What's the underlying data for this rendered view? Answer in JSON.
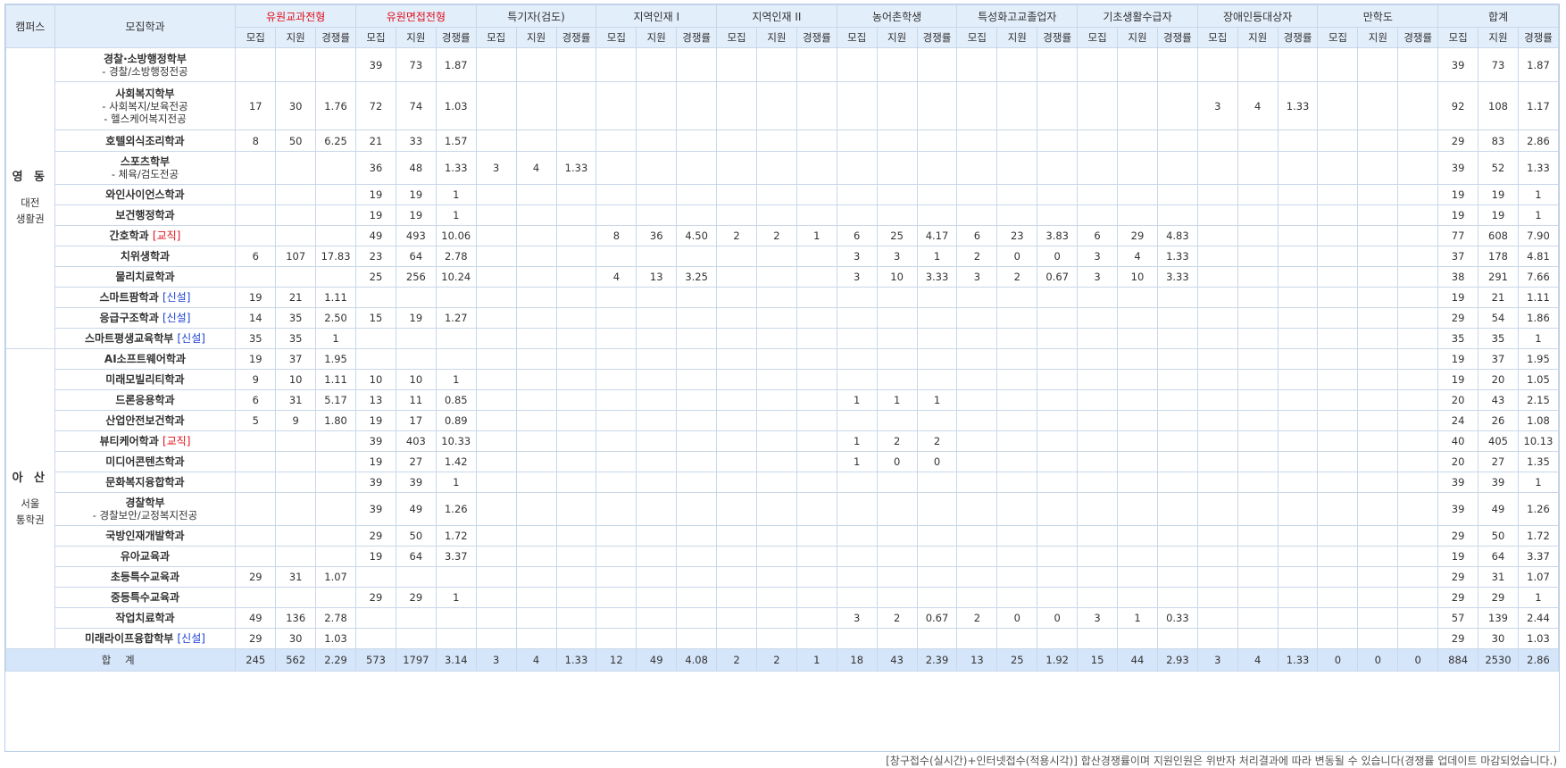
{
  "header": {
    "campus": "캠퍼스",
    "dept": "모집학과",
    "groups": [
      {
        "label": "유원교과전형",
        "red": true
      },
      {
        "label": "유원면접전형",
        "red": true
      },
      {
        "label": "특기자(검도)",
        "red": false
      },
      {
        "label": "지역인재 I",
        "red": false
      },
      {
        "label": "지역인재 II",
        "red": false
      },
      {
        "label": "농어촌학생",
        "red": false
      },
      {
        "label": "특성화고교졸업자",
        "red": false
      },
      {
        "label": "기초생활수급자",
        "red": false
      },
      {
        "label": "장애인등대상자",
        "red": false
      },
      {
        "label": "만학도",
        "red": false
      },
      {
        "label": "합계",
        "red": false
      }
    ],
    "sub": [
      "모집",
      "지원",
      "경쟁률"
    ]
  },
  "campuses": [
    {
      "name": "영 동",
      "region1": "대전",
      "region2": "생활권",
      "rows": [
        {
          "name": "경찰·소방행정학부",
          "sub": [
            "- 경찰/소방행정전공"
          ],
          "h": 38,
          "v": [
            "",
            "",
            "",
            "39",
            "73",
            "1.87",
            "",
            "",
            "",
            "",
            "",
            "",
            "",
            "",
            "",
            "",
            "",
            "",
            "",
            "",
            "",
            "",
            "",
            "",
            "",
            "",
            "",
            "",
            "",
            "",
            "39",
            "73",
            "1.87"
          ]
        },
        {
          "name": "사회복지학부",
          "sub": [
            "- 사회복지/보육전공",
            "- 헬스케어복지전공"
          ],
          "h": 54,
          "v": [
            "17",
            "30",
            "1.76",
            "72",
            "74",
            "1.03",
            "",
            "",
            "",
            "",
            "",
            "",
            "",
            "",
            "",
            "",
            "",
            "",
            "",
            "",
            "",
            "",
            "",
            "",
            "3",
            "4",
            "1.33",
            "",
            "",
            "",
            "92",
            "108",
            "1.17"
          ]
        },
        {
          "name": "호텔외식조리학과",
          "h": 24,
          "v": [
            "8",
            "50",
            "6.25",
            "21",
            "33",
            "1.57",
            "",
            "",
            "",
            "",
            "",
            "",
            "",
            "",
            "",
            "",
            "",
            "",
            "",
            "",
            "",
            "",
            "",
            "",
            "",
            "",
            "",
            "",
            "",
            "",
            "29",
            "83",
            "2.86"
          ]
        },
        {
          "name": "스포츠학부",
          "sub": [
            "- 체육/검도전공"
          ],
          "h": 37,
          "v": [
            "",
            "",
            "",
            "36",
            "48",
            "1.33",
            "3",
            "4",
            "1.33",
            "",
            "",
            "",
            "",
            "",
            "",
            "",
            "",
            "",
            "",
            "",
            "",
            "",
            "",
            "",
            "",
            "",
            "",
            "",
            "",
            "",
            "39",
            "52",
            "1.33"
          ]
        },
        {
          "name": "와인사이언스학과",
          "h": 23,
          "v": [
            "",
            "",
            "",
            "19",
            "19",
            "1",
            "",
            "",
            "",
            "",
            "",
            "",
            "",
            "",
            "",
            "",
            "",
            "",
            "",
            "",
            "",
            "",
            "",
            "",
            "",
            "",
            "",
            "",
            "",
            "",
            "19",
            "19",
            "1"
          ]
        },
        {
          "name": "보건행정학과",
          "h": 23,
          "v": [
            "",
            "",
            "",
            "19",
            "19",
            "1",
            "",
            "",
            "",
            "",
            "",
            "",
            "",
            "",
            "",
            "",
            "",
            "",
            "",
            "",
            "",
            "",
            "",
            "",
            "",
            "",
            "",
            "",
            "",
            "",
            "19",
            "19",
            "1"
          ]
        },
        {
          "name": "간호학과",
          "tag": "[교직]",
          "tagColor": "red",
          "h": 23,
          "v": [
            "",
            "",
            "",
            "49",
            "493",
            "10.06",
            "",
            "",
            "",
            "8",
            "36",
            "4.50",
            "2",
            "2",
            "1",
            "6",
            "25",
            "4.17",
            "6",
            "23",
            "3.83",
            "6",
            "29",
            "4.83",
            "",
            "",
            "",
            "",
            "",
            "",
            "77",
            "608",
            "7.90"
          ]
        },
        {
          "name": "치위생학과",
          "h": 23,
          "v": [
            "6",
            "107",
            "17.83",
            "23",
            "64",
            "2.78",
            "",
            "",
            "",
            "",
            "",
            "",
            "",
            "",
            "",
            "3",
            "3",
            "1",
            "2",
            "0",
            "0",
            "3",
            "4",
            "1.33",
            "",
            "",
            "",
            "",
            "",
            "",
            "37",
            "178",
            "4.81"
          ]
        },
        {
          "name": "물리치료학과",
          "h": 23,
          "v": [
            "",
            "",
            "",
            "25",
            "256",
            "10.24",
            "",
            "",
            "",
            "4",
            "13",
            "3.25",
            "",
            "",
            "",
            "3",
            "10",
            "3.33",
            "3",
            "2",
            "0.67",
            "3",
            "10",
            "3.33",
            "",
            "",
            "",
            "",
            "",
            "",
            "38",
            "291",
            "7.66"
          ]
        },
        {
          "name": "스마트팜학과",
          "tag": "[신설]",
          "tagColor": "blue",
          "h": 23,
          "v": [
            "19",
            "21",
            "1.11",
            "",
            "",
            "",
            "",
            "",
            "",
            "",
            "",
            "",
            "",
            "",
            "",
            "",
            "",
            "",
            "",
            "",
            "",
            "",
            "",
            "",
            "",
            "",
            "",
            "",
            "",
            "",
            "19",
            "21",
            "1.11"
          ]
        },
        {
          "name": "응급구조학과",
          "tag": "[신설]",
          "tagColor": "blue",
          "h": 23,
          "v": [
            "14",
            "35",
            "2.50",
            "15",
            "19",
            "1.27",
            "",
            "",
            "",
            "",
            "",
            "",
            "",
            "",
            "",
            "",
            "",
            "",
            "",
            "",
            "",
            "",
            "",
            "",
            "",
            "",
            "",
            "",
            "",
            "",
            "29",
            "54",
            "1.86"
          ]
        },
        {
          "name": "스마트평생교육학부",
          "tag": "[신설]",
          "tagColor": "blue",
          "h": 23,
          "v": [
            "35",
            "35",
            "1",
            "",
            "",
            "",
            "",
            "",
            "",
            "",
            "",
            "",
            "",
            "",
            "",
            "",
            "",
            "",
            "",
            "",
            "",
            "",
            "",
            "",
            "",
            "",
            "",
            "",
            "",
            "",
            "35",
            "35",
            "1"
          ]
        }
      ]
    },
    {
      "name": "아 산",
      "region1": "서울",
      "region2": "통학권",
      "rows": [
        {
          "name": "AI소프트웨어학과",
          "h": 23,
          "v": [
            "19",
            "37",
            "1.95",
            "",
            "",
            "",
            "",
            "",
            "",
            "",
            "",
            "",
            "",
            "",
            "",
            "",
            "",
            "",
            "",
            "",
            "",
            "",
            "",
            "",
            "",
            "",
            "",
            "",
            "",
            "",
            "19",
            "37",
            "1.95"
          ]
        },
        {
          "name": "미래모빌리티학과",
          "h": 23,
          "v": [
            "9",
            "10",
            "1.11",
            "10",
            "10",
            "1",
            "",
            "",
            "",
            "",
            "",
            "",
            "",
            "",
            "",
            "",
            "",
            "",
            "",
            "",
            "",
            "",
            "",
            "",
            "",
            "",
            "",
            "",
            "",
            "",
            "19",
            "20",
            "1.05"
          ]
        },
        {
          "name": "드론응용학과",
          "h": 23,
          "v": [
            "6",
            "31",
            "5.17",
            "13",
            "11",
            "0.85",
            "",
            "",
            "",
            "",
            "",
            "",
            "",
            "",
            "",
            "1",
            "1",
            "1",
            "",
            "",
            "",
            "",
            "",
            "",
            "",
            "",
            "",
            "",
            "",
            "",
            "20",
            "43",
            "2.15"
          ]
        },
        {
          "name": "산업안전보건학과",
          "h": 23,
          "v": [
            "5",
            "9",
            "1.80",
            "19",
            "17",
            "0.89",
            "",
            "",
            "",
            "",
            "",
            "",
            "",
            "",
            "",
            "",
            "",
            "",
            "",
            "",
            "",
            "",
            "",
            "",
            "",
            "",
            "",
            "",
            "",
            "",
            "24",
            "26",
            "1.08"
          ]
        },
        {
          "name": "뷰티케어학과",
          "tag": "[교직]",
          "tagColor": "red",
          "h": 23,
          "v": [
            "",
            "",
            "",
            "39",
            "403",
            "10.33",
            "",
            "",
            "",
            "",
            "",
            "",
            "",
            "",
            "",
            "1",
            "2",
            "2",
            "",
            "",
            "",
            "",
            "",
            "",
            "",
            "",
            "",
            "",
            "",
            "",
            "40",
            "405",
            "10.13"
          ]
        },
        {
          "name": "미디어콘텐츠학과",
          "h": 23,
          "v": [
            "",
            "",
            "",
            "19",
            "27",
            "1.42",
            "",
            "",
            "",
            "",
            "",
            "",
            "",
            "",
            "",
            "1",
            "0",
            "0",
            "",
            "",
            "",
            "",
            "",
            "",
            "",
            "",
            "",
            "",
            "",
            "",
            "20",
            "27",
            "1.35"
          ]
        },
        {
          "name": "문화복지융합학과",
          "h": 23,
          "v": [
            "",
            "",
            "",
            "39",
            "39",
            "1",
            "",
            "",
            "",
            "",
            "",
            "",
            "",
            "",
            "",
            "",
            "",
            "",
            "",
            "",
            "",
            "",
            "",
            "",
            "",
            "",
            "",
            "",
            "",
            "",
            "39",
            "39",
            "1"
          ]
        },
        {
          "name": "경찰학부",
          "sub": [
            "- 경찰보안/교정복지전공"
          ],
          "h": 37,
          "v": [
            "",
            "",
            "",
            "39",
            "49",
            "1.26",
            "",
            "",
            "",
            "",
            "",
            "",
            "",
            "",
            "",
            "",
            "",
            "",
            "",
            "",
            "",
            "",
            "",
            "",
            "",
            "",
            "",
            "",
            "",
            "",
            "39",
            "49",
            "1.26"
          ]
        },
        {
          "name": "국방인재개발학과",
          "h": 23,
          "v": [
            "",
            "",
            "",
            "29",
            "50",
            "1.72",
            "",
            "",
            "",
            "",
            "",
            "",
            "",
            "",
            "",
            "",
            "",
            "",
            "",
            "",
            "",
            "",
            "",
            "",
            "",
            "",
            "",
            "",
            "",
            "",
            "29",
            "50",
            "1.72"
          ]
        },
        {
          "name": "유아교육과",
          "h": 23,
          "v": [
            "",
            "",
            "",
            "19",
            "64",
            "3.37",
            "",
            "",
            "",
            "",
            "",
            "",
            "",
            "",
            "",
            "",
            "",
            "",
            "",
            "",
            "",
            "",
            "",
            "",
            "",
            "",
            "",
            "",
            "",
            "",
            "19",
            "64",
            "3.37"
          ]
        },
        {
          "name": "초등특수교육과",
          "h": 23,
          "v": [
            "29",
            "31",
            "1.07",
            "",
            "",
            "",
            "",
            "",
            "",
            "",
            "",
            "",
            "",
            "",
            "",
            "",
            "",
            "",
            "",
            "",
            "",
            "",
            "",
            "",
            "",
            "",
            "",
            "",
            "",
            "",
            "29",
            "31",
            "1.07"
          ]
        },
        {
          "name": "중등특수교육과",
          "h": 23,
          "v": [
            "",
            "",
            "",
            "29",
            "29",
            "1",
            "",
            "",
            "",
            "",
            "",
            "",
            "",
            "",
            "",
            "",
            "",
            "",
            "",
            "",
            "",
            "",
            "",
            "",
            "",
            "",
            "",
            "",
            "",
            "",
            "29",
            "29",
            "1"
          ]
        },
        {
          "name": "작업치료학과",
          "h": 23,
          "v": [
            "49",
            "136",
            "2.78",
            "",
            "",
            "",
            "",
            "",
            "",
            "",
            "",
            "",
            "",
            "",
            "",
            "3",
            "2",
            "0.67",
            "2",
            "0",
            "0",
            "3",
            "1",
            "0.33",
            "",
            "",
            "",
            "",
            "",
            "",
            "57",
            "139",
            "2.44"
          ]
        },
        {
          "name": "미래라이프융합학부",
          "tag": "[신설]",
          "tagColor": "blue",
          "h": 23,
          "v": [
            "29",
            "30",
            "1.03",
            "",
            "",
            "",
            "",
            "",
            "",
            "",
            "",
            "",
            "",
            "",
            "",
            "",
            "",
            "",
            "",
            "",
            "",
            "",
            "",
            "",
            "",
            "",
            "",
            "",
            "",
            "",
            "29",
            "30",
            "1.03"
          ]
        }
      ]
    }
  ],
  "total": {
    "label": "합 계",
    "v": [
      "245",
      "562",
      "2.29",
      "573",
      "1797",
      "3.14",
      "3",
      "4",
      "1.33",
      "12",
      "49",
      "4.08",
      "2",
      "2",
      "1",
      "18",
      "43",
      "2.39",
      "13",
      "25",
      "1.92",
      "15",
      "44",
      "2.93",
      "3",
      "4",
      "1.33",
      "0",
      "0",
      "0",
      "884",
      "2530",
      "2.86"
    ]
  },
  "note": "[창구접수(실시간)+인터넷접수(적용시각)] 합산경쟁률이며 지원인원은 위반자 처리결과에 따라 변동될 수 있습니다(경쟁률 업데이트 마감되었습니다.)",
  "colors": {
    "header_bg": "#e3eefb",
    "total_bg": "#d6e6fa",
    "border": "#c9d7ea",
    "red": "#e0101a",
    "blue": "#1a3fd6"
  }
}
